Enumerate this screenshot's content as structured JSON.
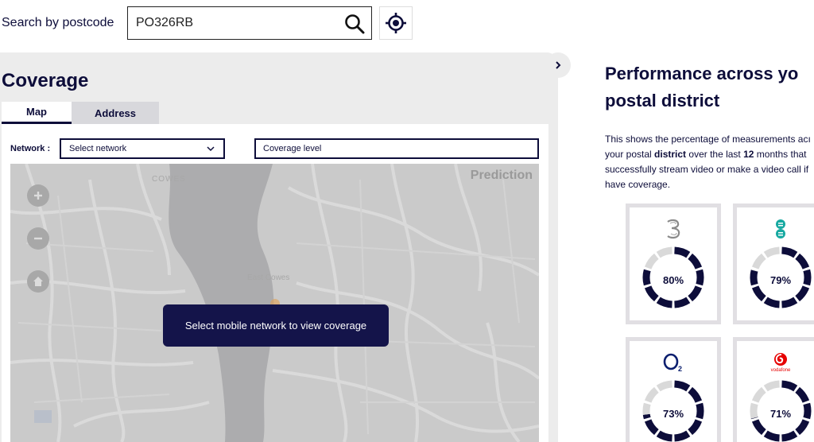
{
  "search": {
    "label": "Search by postcode",
    "value": "PO326RB"
  },
  "coverage": {
    "title": "Coverage",
    "tabs": [
      {
        "label": "Map",
        "active": true
      },
      {
        "label": "Address",
        "active": false
      }
    ],
    "network_label": "Network :",
    "network_select": "Select network",
    "coverage_level": "Coverage level",
    "map": {
      "overlay_label": "Prediction",
      "message": "Select mobile network to view coverage",
      "place_labels": [
        "COWES",
        "East Cowes"
      ]
    }
  },
  "performance": {
    "title_line1": "Performance across yo",
    "title_line2": "postal district",
    "text_parts": [
      "This shows the percentage of measurements acı",
      "your postal ",
      "district",
      " over the last ",
      "12",
      " months that",
      "successfully stream video or make a video call if",
      "have coverage."
    ],
    "operators": [
      {
        "name": "Three",
        "logo": "3",
        "percent": 80,
        "label": "80%"
      },
      {
        "name": "EE",
        "logo": "EE",
        "percent": 79,
        "label": "79%"
      },
      {
        "name": "O2",
        "logo": "O2",
        "percent": 73,
        "label": "73%"
      },
      {
        "name": "Vodafone",
        "logo": "vodafone",
        "percent": 71,
        "label": "71%"
      }
    ]
  },
  "colors": {
    "navy": "#0d0d3a",
    "ring_bg": "#d9d9d9",
    "panel_bg": "#ececec",
    "ee_teal": "#17a9a1",
    "vodafone_red": "#e60000",
    "o2_blue": "#0a1e6e"
  }
}
